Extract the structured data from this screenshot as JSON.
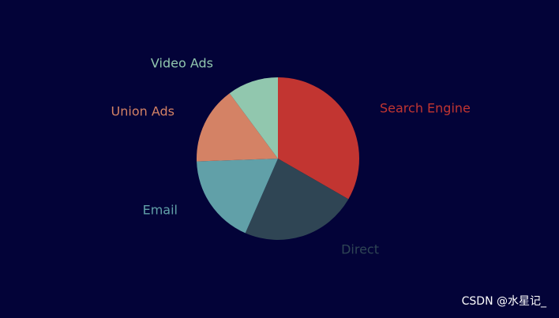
{
  "chart_data": {
    "type": "pie",
    "title": "",
    "slices": [
      {
        "name": "Search Engine",
        "value": 335,
        "color": "#c23531"
      },
      {
        "name": "Direct",
        "value": 234,
        "color": "#2f4554"
      },
      {
        "name": "Email",
        "value": 180,
        "color": "#61a0a8"
      },
      {
        "name": "Union Ads",
        "value": 155,
        "color": "#d48265"
      },
      {
        "name": "Video Ads",
        "value": 102,
        "color": "#91c7ae"
      }
    ],
    "start": "top, clockwise"
  },
  "background": "#030338",
  "watermark": "CSDN @水星记_"
}
